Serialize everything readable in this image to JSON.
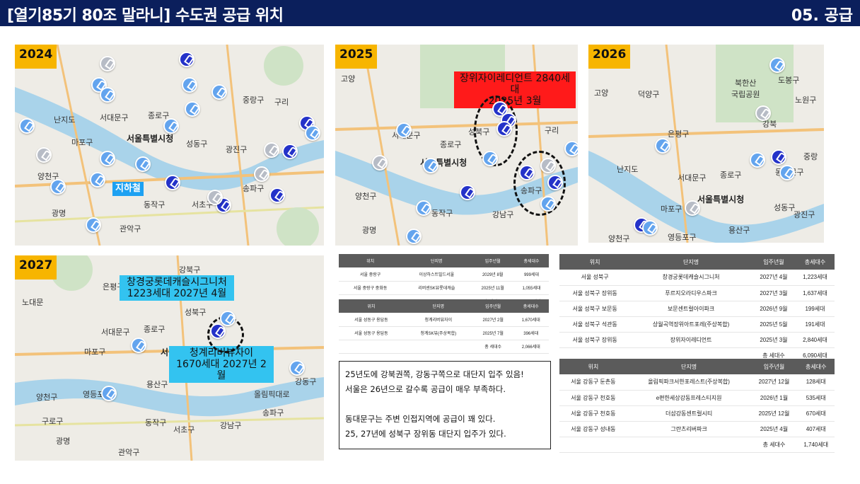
{
  "header": {
    "title": "[열기85기 80조 말라니] 수도권 공급 위치",
    "section": "05. 공급"
  },
  "maps": {
    "y2024": {
      "year": "2024",
      "places": [
        "서울특별시청",
        "종로구",
        "서대문구",
        "마포구",
        "중랑구",
        "구리",
        "광진구",
        "송파구",
        "서초구",
        "동작구",
        "관악구",
        "양천구",
        "광명",
        "난지도",
        "성동구"
      ],
      "subway_label": "지하철"
    },
    "y2025": {
      "year": "2025",
      "places": [
        "고양",
        "서울특별시청",
        "서대문구",
        "성북구",
        "구리",
        "송파구",
        "강남구",
        "동작구",
        "양천구",
        "광명",
        "종로구"
      ],
      "callout": "장위자이레디언트 2840세대\n2025년 3월"
    },
    "y2026": {
      "year": "2026",
      "places": [
        "고양",
        "덕양구",
        "북한산\n국립공원",
        "도봉구",
        "노원구",
        "은평구",
        "강북",
        "서대문구",
        "종로구",
        "서울특별시청",
        "마포구",
        "난지도",
        "중랑",
        "동대문구",
        "성동구",
        "광진구",
        "용산구",
        "영등포구",
        "양천구"
      ]
    },
    "y2027": {
      "year": "2027",
      "places": [
        "강북구",
        "은평구",
        "노대문",
        "서대문구",
        "종로구",
        "서울특별시청",
        "마포구",
        "용산구",
        "성북구",
        "강동구",
        "영등포구",
        "양천구",
        "올림픽대로",
        "송파구",
        "강남구",
        "동작구",
        "서초구",
        "구로구",
        "광명",
        "관악구"
      ],
      "callout1": "창경궁롯데캐슬시그니처\n1223세대 2027년 4월",
      "callout2": "청계리버뷰자이\n1670세대 2027년 2월"
    }
  },
  "table_small_1": {
    "headers": [
      "위치",
      "단지명",
      "입주년월",
      "총세대수"
    ],
    "rows": [
      [
        "서울 중랑구",
        "이상하스트빌드서울",
        "2029년 8월",
        "999세대"
      ],
      [
        "서울 중랑구 중화동",
        "리버센SK뷰롯데캐슬",
        "2025년 11월",
        "1,055세대"
      ],
      [
        "",
        "",
        "총 세대수",
        "2,054세대"
      ]
    ]
  },
  "table_small_2": {
    "headers": [
      "위치",
      "단지명",
      "입주년월",
      "총세대수"
    ],
    "rows": [
      [
        "서울 성동구 용답동",
        "청계리버뷰자이",
        "2027년 2월",
        "1,670세대"
      ],
      [
        "서울 성동구 용답동",
        "청계SK뷰(주상복합)",
        "2025년 7월",
        "396세대"
      ],
      [
        "",
        "",
        "총 세대수",
        "2,066세대"
      ]
    ]
  },
  "table_large_1": {
    "headers": [
      "위치",
      "단지명",
      "입주년월",
      "총세대수"
    ],
    "rows": [
      [
        "서울 성북구",
        "창경궁롯데캐슬시그니처",
        "2027년 4월",
        "1,223세대"
      ],
      [
        "서울 성북구 장위동",
        "푸르지오라디우스파크",
        "2027년 3월",
        "1,637세대"
      ],
      [
        "서울 성북구 보문동",
        "보문센트럴아이파크",
        "2026년 9월",
        "199세대"
      ],
      [
        "서울 성북구 석관동",
        "상월곡역장위아트포레(주상복합)",
        "2025년 5월",
        "191세대"
      ],
      [
        "서울 성북구 장위동",
        "장위자이레디언트",
        "2025년 3월",
        "2,840세대"
      ],
      [
        "",
        "",
        "총 세대수",
        "6,090세대"
      ]
    ]
  },
  "table_large_2": {
    "headers": [
      "위치",
      "단지명",
      "입주년월",
      "총세대수"
    ],
    "rows": [
      [
        "서울 강동구 둔촌동",
        "올림픽파크서한포레스트(주상복합)",
        "2027년 12월",
        "128세대"
      ],
      [
        "서울 강동구 천호동",
        "e편한세상강동프레스티지원",
        "2026년 1월",
        "535세대"
      ],
      [
        "서울 강동구 천호동",
        "더샵강동센트럴시티",
        "2025년 12월",
        "670세대"
      ],
      [
        "서울 강동구 성내동",
        "그란츠리버파크",
        "2025년 4월",
        "407세대"
      ],
      [
        "",
        "",
        "총 세대수",
        "1,740세대"
      ]
    ]
  },
  "note": {
    "line1": "25년도에 강북권쪽, 강동구쪽으로 대단지 입주 있음!",
    "line2": "서울은 26년으로 갈수록 공급이 매우 부족하다.",
    "line3": "",
    "line4": "동대문구는 주변 인접지역에 공급이 꽤 있다.",
    "line5": "25, 27년에 성북구 장위동 대단지 입주가 있다."
  },
  "colors": {
    "header_bg": "#0b1f5c",
    "badge": "#f7b500",
    "pin_light": "#63a4ee",
    "pin_dark": "#2432c9",
    "river": "#a9d3ea"
  }
}
